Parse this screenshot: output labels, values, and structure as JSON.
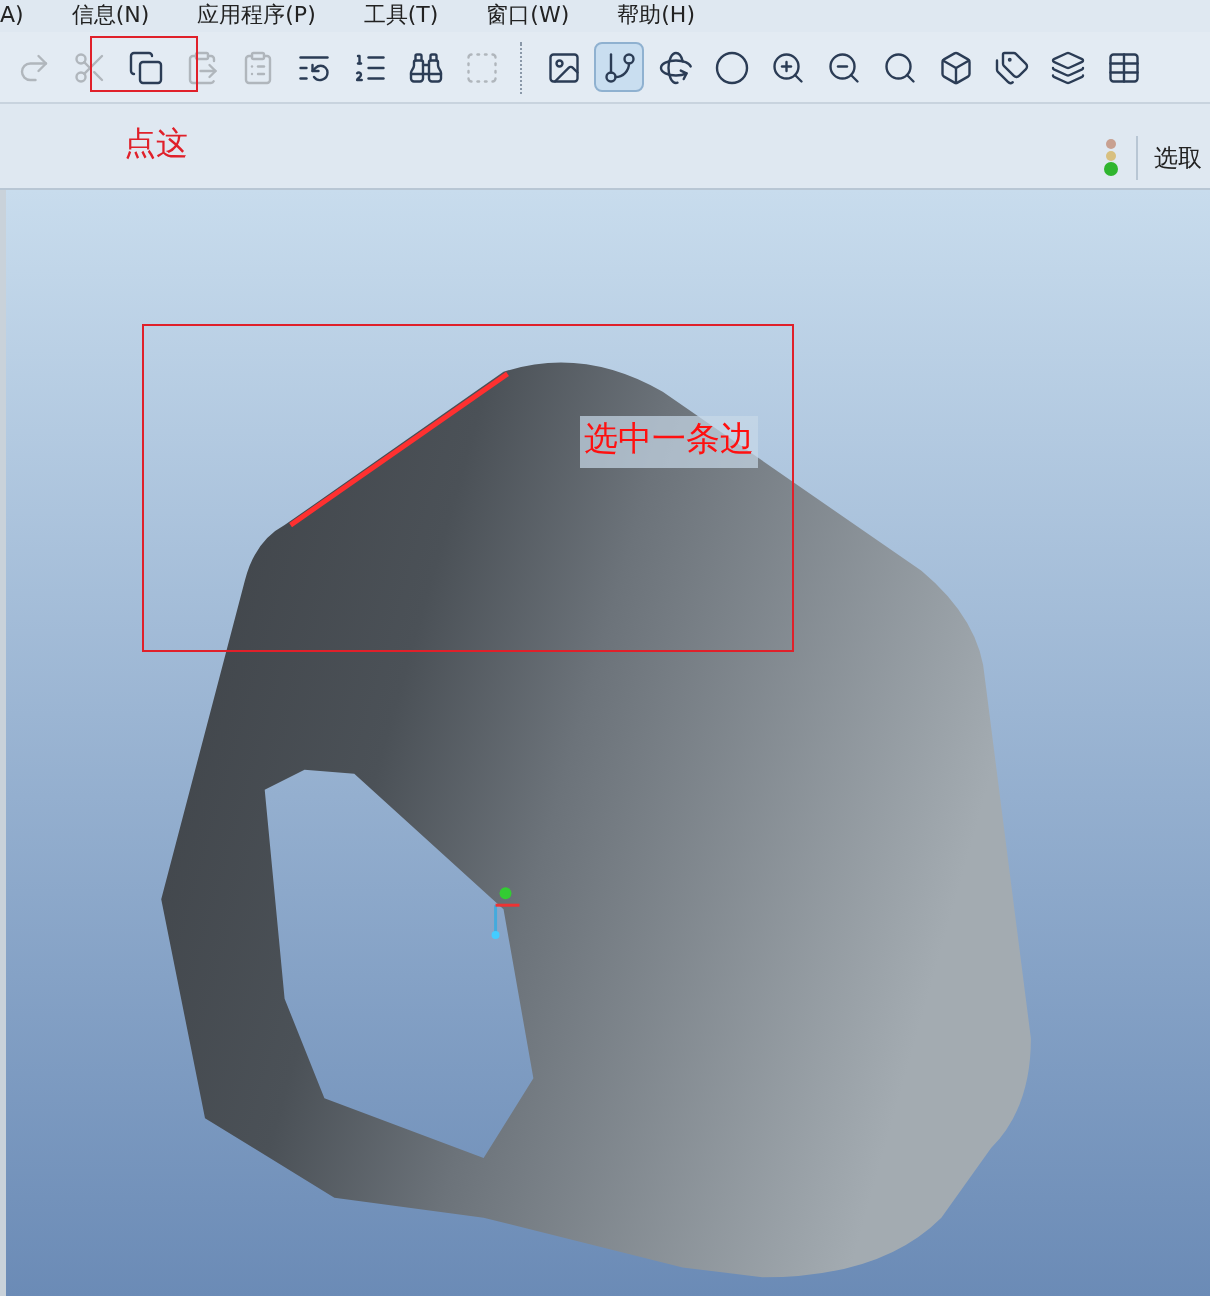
{
  "menu_bar": [
    "A)",
    "信息(N)",
    "应用程序(P)",
    "工具(T)",
    "窗口(W)",
    "帮助(H)"
  ],
  "toolbar_buttons": [
    {
      "disabled": true,
      "selected": false
    },
    {
      "disabled": true,
      "selected": false
    },
    {
      "disabled": false,
      "selected": false
    },
    {
      "disabled": true,
      "selected": false
    },
    {
      "disabled": true,
      "selected": false
    },
    {
      "disabled": false,
      "selected": false
    },
    {
      "disabled": false,
      "selected": false
    },
    {
      "disabled": false,
      "selected": false
    },
    {
      "disabled": true,
      "selected": false
    },
    {
      "disabled": false,
      "selected": false
    },
    {
      "disabled": false,
      "selected": true
    },
    {
      "disabled": false,
      "selected": false
    },
    {
      "disabled": false,
      "selected": false
    },
    {
      "disabled": false,
      "selected": false
    },
    {
      "disabled": false,
      "selected": false
    },
    {
      "disabled": false,
      "selected": false
    },
    {
      "disabled": false,
      "selected": false
    },
    {
      "disabled": false,
      "selected": false
    },
    {
      "disabled": false,
      "selected": false
    },
    {
      "disabled": false,
      "selected": false
    }
  ],
  "annotations": {
    "toolbar_note": "点这",
    "viewport_note": "选中一条边"
  },
  "status": {
    "filter_label": "选取"
  }
}
